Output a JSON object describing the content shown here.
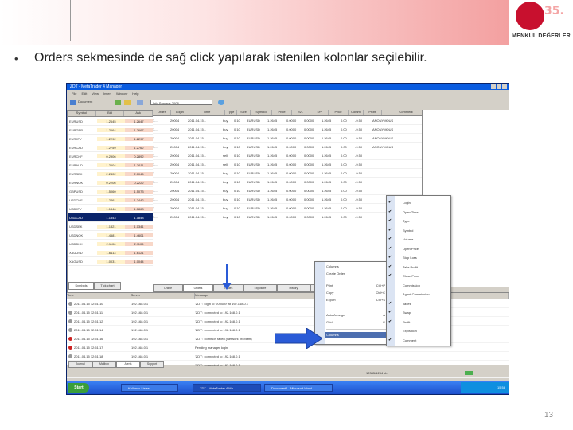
{
  "slide": {
    "bullet": "•",
    "text": "Orders sekmesinde de sağ click yapılarak istenilen kolonlar seçilebilir.",
    "page_number": "13",
    "logo_number": "35.",
    "logo_text": "MENKUL DEĞERLER"
  },
  "app": {
    "title": "ZDT - MetaTrader 4 Manager",
    "menu": [
      "File",
      "Edit",
      "View",
      "Insert",
      "Window",
      "Help"
    ],
    "toolbar": {
      "new_label": "Document",
      "combo_value": "Info Servers: 2008"
    },
    "market_watch": {
      "headers": [
        "Symbol",
        "Bid",
        "Ask"
      ],
      "rows": [
        {
          "sym": "EURUSD",
          "bid": "1.2645",
          "ask": "1.2647"
        },
        {
          "sym": "EURGBP",
          "bid": "1.2664",
          "ask": "1.2667"
        },
        {
          "sym": "EURJPY",
          "bid": "1.2292",
          "ask": "1.2297"
        },
        {
          "sym": "EURCAD",
          "bid": "1.2759",
          "ask": "1.2762"
        },
        {
          "sym": "EURCHF",
          "bid": "0.2906",
          "ask": "0.2892"
        },
        {
          "sym": "EURAUD",
          "bid": "1.2604",
          "ask": "1.2611"
        },
        {
          "sym": "EURSEK",
          "bid": "2.2402",
          "ask": "2.1046"
        },
        {
          "sym": "EURNOK",
          "bid": "0.2206",
          "ask": "0.2222"
        },
        {
          "sym": "GBPUSD",
          "bid": "1.5060",
          "ask": "1.5073"
        },
        {
          "sym": "USDCHF",
          "bid": "1.2461",
          "ask": "1.2442"
        },
        {
          "sym": "USDJPY",
          "bid": "1.1846",
          "ask": "1.1868"
        },
        {
          "sym": "USDCAD",
          "bid": "1.1843",
          "ask": "1.1848"
        },
        {
          "sym": "USDSEK",
          "bid": "1.1321",
          "ask": "1.1341"
        },
        {
          "sym": "USDNOK",
          "bid": "1.4581",
          "ask": "1.4601"
        },
        {
          "sym": "USDDKK",
          "bid": "2.1106",
          "ask": "2.1106"
        },
        {
          "sym": "XAUUSD",
          "bid": "1.6113",
          "ask": "1.6121"
        },
        {
          "sym": "XAGUSD",
          "bid": "1.0031",
          "ask": "1.0044"
        }
      ]
    },
    "orders": {
      "headers": [
        "Order",
        "Login",
        "Time",
        "Type",
        "Size",
        "Symbol",
        "Price",
        "S/L",
        "T/P",
        "Price",
        "Comm",
        "Profit",
        "Comment"
      ],
      "rows": [
        [
          "1...",
          "20004",
          "2011.04.15...",
          "buy",
          "0.10",
          "EURUSD",
          "1.2645",
          "0.0000",
          "0.0000",
          "1.2645",
          "0.00",
          "-9.50",
          "ANONYMOUS"
        ],
        [
          "1...",
          "20004",
          "2011.04.15...",
          "buy",
          "0.10",
          "EURUSD",
          "1.2645",
          "0.0000",
          "0.0000",
          "1.2645",
          "0.00",
          "-9.50",
          "ANONYMOUS"
        ],
        [
          "1...",
          "20004",
          "2011.04.15...",
          "buy",
          "0.10",
          "EURUSD",
          "1.2645",
          "0.0000",
          "0.0000",
          "1.2645",
          "0.00",
          "-9.50",
          "ANONYMOUS"
        ],
        [
          "1...",
          "20004",
          "2011.04.15...",
          "buy",
          "0.10",
          "EURUSD",
          "1.2645",
          "0.0000",
          "0.0000",
          "1.2645",
          "0.00",
          "-9.50",
          "ANONYMOUS"
        ],
        [
          "1...",
          "20004",
          "2011.04.15...",
          "sell",
          "0.10",
          "EURUSD",
          "1.2645",
          "0.0000",
          "0.0000",
          "1.2645",
          "0.00",
          "-9.50",
          ""
        ],
        [
          "1...",
          "20004",
          "2011.04.15...",
          "sell",
          "0.10",
          "EURUSD",
          "1.2645",
          "0.0000",
          "0.0000",
          "1.2645",
          "0.00",
          "-9.50",
          ""
        ],
        [
          "1...",
          "20004",
          "2011.04.15...",
          "buy",
          "0.10",
          "EURUSD",
          "1.2645",
          "0.0000",
          "0.0000",
          "1.2645",
          "0.00",
          "-9.50",
          ""
        ],
        [
          "1...",
          "20004",
          "2011.04.15...",
          "buy",
          "0.10",
          "EURUSD",
          "1.2645",
          "0.0000",
          "0.0000",
          "1.2645",
          "0.00",
          "-9.50",
          ""
        ],
        [
          "1...",
          "20004",
          "2011.04.15...",
          "buy",
          "0.10",
          "EURUSD",
          "1.2645",
          "0.0000",
          "0.0000",
          "1.2645",
          "0.00",
          "-9.50",
          ""
        ],
        [
          "1...",
          "20004",
          "2011.04.15...",
          "buy",
          "0.10",
          "EURUSD",
          "1.2645",
          "0.0000",
          "0.0000",
          "1.2645",
          "0.00",
          "-9.50",
          ""
        ],
        [
          "1...",
          "20004",
          "2011.04.15...",
          "buy",
          "0.10",
          "EURUSD",
          "1.2645",
          "0.0000",
          "0.0000",
          "1.2645",
          "0.00",
          "-9.50",
          ""
        ],
        [
          "1...",
          "20004",
          "2011.04.15...",
          "buy",
          "0.10",
          "EURUSD",
          "1.2645",
          "0.0000",
          "0.0000",
          "1.2645",
          "0.00",
          "-9.50",
          ""
        ]
      ]
    },
    "mw_tabs": [
      "Symbols",
      "Tick chart"
    ],
    "lower_tabs": [
      "Online",
      "Orders",
      "Trades",
      "Exposure",
      "History",
      "Summary"
    ],
    "terminal": {
      "headers": [
        "Time",
        "Server",
        "Message"
      ],
      "rows": [
        {
          "t": "2011.04.15 12:51:10",
          "s": "192.168.0.1",
          "m": "'ZDT': login to '200089' at 192.168.0.1"
        },
        {
          "t": "2011.04.15 12:51:11",
          "s": "192.168.0.1",
          "m": "'ZDT': connected to 192.168.0.1"
        },
        {
          "t": "2011.04.15 12:51:12",
          "s": "192.168.0.1",
          "m": "'ZDT': connected to 192.168.0.1"
        },
        {
          "t": "2011.04.15 12:51:14",
          "s": "192.168.0.1",
          "m": "'ZDT': connected to 192.168.0.1"
        },
        {
          "t": "2011.04.15 12:51:16",
          "s": "192.168.0.1",
          "m": "'ZDT': common failed (Network problem)"
        },
        {
          "t": "2011.04.15 12:51:17",
          "s": "192.168.0.1",
          "m": "Pending manager login"
        },
        {
          "t": "2011.04.15 12:51:18",
          "s": "192.168.0.1",
          "m": "'ZDT': connected to 192.168.0.1"
        },
        {
          "t": "2011.04.15 12:51:19",
          "s": "192.168.0.1",
          "m": "'ZDT': connected to 192.168.0.1"
        },
        {
          "t": "2011.04.15 12:51:20",
          "s": "192.168.0.1",
          "m": "'ZDT': connected to 192.168.0.1"
        }
      ],
      "tabs": [
        "Journal",
        "Mailbox",
        "Alerts",
        "Support"
      ]
    },
    "status": {
      "left": "",
      "right": "12345/1234 kb"
    },
    "taskbar": {
      "start": "Start",
      "tasks": [
        "Kullanıcı Listesi",
        "ZDT - MetaTrader 4 Ma...",
        "Document1 - Microsoft Word"
      ],
      "clock": "15:58"
    },
    "context_menu": {
      "items": [
        {
          "label": "Columns",
          "shortcut": ""
        },
        {
          "label": "Create Order",
          "shortcut": ""
        },
        {
          "label": "Print",
          "shortcut": "Ctrl+P"
        },
        {
          "label": "Copy",
          "shortcut": "Ctrl+C"
        },
        {
          "label": "Export",
          "shortcut": "Ctrl+S"
        },
        {
          "label": "Auto Arrange",
          "shortcut": "A"
        },
        {
          "label": "Grid",
          "shortcut": "G"
        },
        {
          "label": "Columns",
          "shortcut": ""
        }
      ]
    },
    "columns_menu": {
      "items": [
        {
          "label": "Login",
          "checked": true
        },
        {
          "label": "Open Time",
          "checked": true
        },
        {
          "label": "Type",
          "checked": true
        },
        {
          "label": "Symbol",
          "checked": true
        },
        {
          "label": "Volume",
          "checked": true
        },
        {
          "label": "Open Price",
          "checked": true
        },
        {
          "label": "Stop Loss",
          "checked": true
        },
        {
          "label": "Take Profit",
          "checked": true
        },
        {
          "label": "Close Price",
          "checked": true
        },
        {
          "label": "Commission",
          "checked": false
        },
        {
          "label": "Agent Commission",
          "checked": false
        },
        {
          "label": "Taxes",
          "checked": true
        },
        {
          "label": "Swap",
          "checked": true
        },
        {
          "label": "Profit",
          "checked": true
        },
        {
          "label": "Expiration",
          "checked": false
        },
        {
          "label": "Comment",
          "checked": true
        }
      ]
    }
  },
  "colors": {
    "accent": "#c8102e",
    "window_blue": "#0a5ce0",
    "arrow_blue": "#2a5bd7",
    "menu_highlight": "#4d6fb0"
  }
}
